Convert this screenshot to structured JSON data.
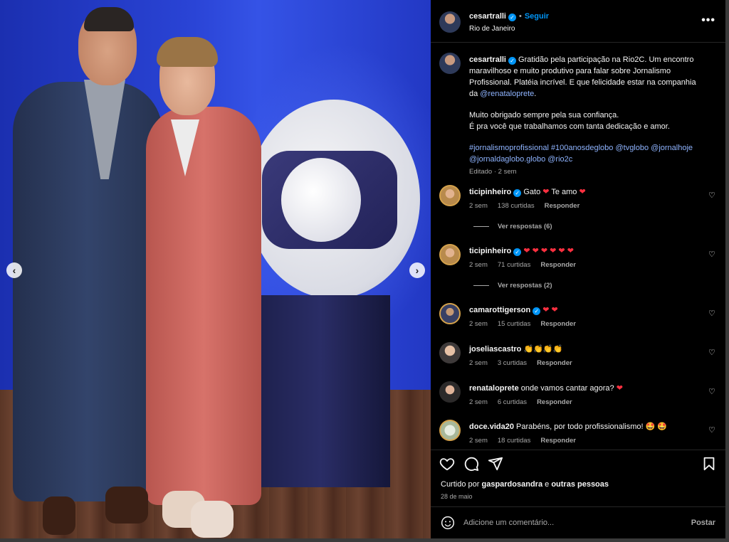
{
  "post": {
    "username": "cesartralli",
    "follow_label": "Seguir",
    "location": "Rio de Janeiro",
    "more_label": "•••"
  },
  "caption": {
    "username": "cesartralli",
    "line1": "Gratidão pela participação na Rio2C. Um encontro maravilhoso e muito produtivo para falar sobre Jornalismo Profissional. Platéia incrível. E que felicidade estar na companhia da ",
    "mention": "@renataloprete",
    "line1_end": ".",
    "para2_l1": "Muito obrigado sempre pela sua confiança.",
    "para2_l2": "É pra você que trabalhamos com tanta dedicação e amor.",
    "tags": "#jornalismoprofissional #100anosdeglobo @tvglobo @jornalhoje @jornaldaglobo.globo @rio2c",
    "edited": "Editado · 2 sem"
  },
  "comments": [
    {
      "user": "ticipinheiro",
      "verified": true,
      "pre": "Gato ",
      "h1": "❤",
      "mid": " Te amo ",
      "h2": "❤",
      "time": "2 sem",
      "likes": "138 curtidas",
      "reply": "Responder"
    },
    {
      "user": "ticipinheiro",
      "verified": true,
      "pre": "",
      "hearts": "❤ ❤ ❤ ❤ ❤ ❤",
      "time": "2 sem",
      "likes": "71 curtidas",
      "reply": "Responder"
    },
    {
      "user": "camarottigerson",
      "verified": true,
      "hearts": "❤ ❤",
      "time": "2 sem",
      "likes": "15 curtidas",
      "reply": "Responder"
    },
    {
      "user": "joseliascastro",
      "verified": false,
      "text": "👏👏👏👏",
      "time": "2 sem",
      "likes": "3 curtidas",
      "reply": "Responder"
    },
    {
      "user": "renataloprete",
      "verified": false,
      "text": "onde vamos cantar agora? ",
      "heart": "❤",
      "time": "2 sem",
      "likes": "6 curtidas",
      "reply": "Responder"
    },
    {
      "user": "doce.vida20",
      "verified": false,
      "text": "Parabéns, por todo profissionalismo! 🤩 🤩",
      "time": "2 sem",
      "likes": "18 curtidas",
      "reply": "Responder"
    }
  ],
  "replies": [
    {
      "label": "Ver respostas (6)"
    },
    {
      "label": "Ver respostas (2)"
    }
  ],
  "footer": {
    "liked_prefix": "Curtido por ",
    "liked_user": "gaspardosandra",
    "liked_mid": " e ",
    "liked_others": "outras pessoas",
    "date": "28 de maio",
    "comment_placeholder": "Adicione um comentário...",
    "post_label": "Postar"
  },
  "nav": {
    "prev": "‹",
    "next": "›"
  },
  "colors": {
    "accent": "#0095f6",
    "heart": "#ff3040",
    "panel_bg": "#000000"
  }
}
